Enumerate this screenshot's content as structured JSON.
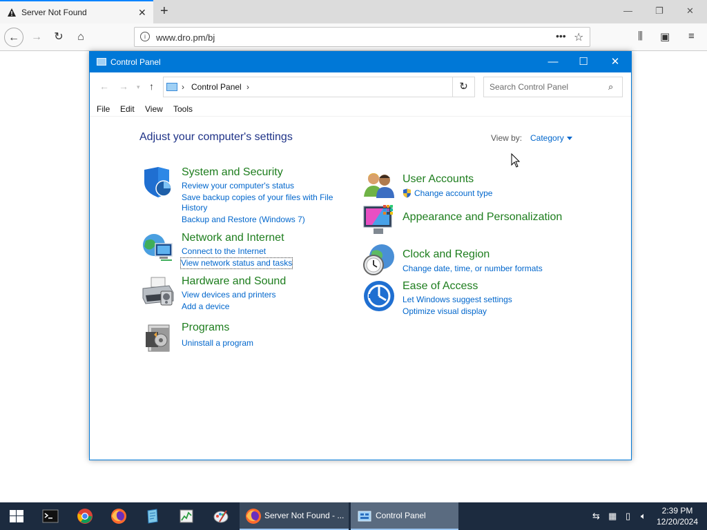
{
  "browser": {
    "tab_title": "Server Not Found",
    "url": "www.dro.pm/bj",
    "new_tab": "+",
    "close_tab": "✕"
  },
  "window": {
    "title": "Control Panel",
    "breadcrumb": "Control Panel",
    "search_placeholder": "Search Control Panel",
    "menu": [
      "File",
      "Edit",
      "View",
      "Tools"
    ]
  },
  "content": {
    "heading": "Adjust your computer's settings",
    "view_by_label": "View by:",
    "view_by_value": "Category",
    "categories": [
      {
        "title": "System and Security",
        "icon": "shield-icon",
        "links": [
          "Review your computer's status",
          "Save backup copies of your files with File",
          "History",
          "Backup and Restore (Windows 7)"
        ]
      },
      {
        "title": "Network and Internet",
        "icon": "globe-network-icon",
        "links": [
          "Connect to the Internet",
          "View network status and tasks"
        ]
      },
      {
        "title": "Hardware and Sound",
        "icon": "printer-icon",
        "links": [
          "View devices and printers",
          "Add a device"
        ]
      },
      {
        "title": "Programs",
        "icon": "programs-icon",
        "links": [
          "Uninstall a program"
        ]
      },
      {
        "title": "User Accounts",
        "icon": "users-icon",
        "links": [
          "Change account type"
        ]
      },
      {
        "title": "Appearance and Personalization",
        "icon": "monitor-icon",
        "links": []
      },
      {
        "title": "Clock and Region",
        "icon": "clock-globe-icon",
        "links": [
          "Change date, time, or number formats"
        ]
      },
      {
        "title": "Ease of Access",
        "icon": "ease-of-access-icon",
        "links": [
          "Let Windows suggest settings",
          "Optimize visual display"
        ]
      }
    ]
  },
  "taskbar": {
    "apps": [
      {
        "label": "Server Not Found - ..."
      },
      {
        "label": "Control Panel"
      }
    ],
    "time": "2:39 PM",
    "date": "12/20/2024"
  },
  "colors": {
    "accent": "#0078d7",
    "category_title": "#1d7d1d",
    "link": "#0066cc",
    "heading": "#1e3287",
    "taskbar": "#1c2b3f"
  }
}
